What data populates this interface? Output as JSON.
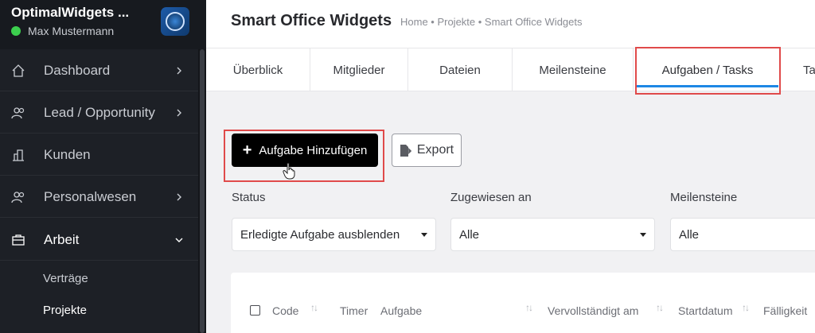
{
  "sidebar": {
    "app_title": "OptimalWidgets ...",
    "user_name": "Max Mustermann",
    "items": [
      {
        "label": "Dashboard",
        "icon": "home-icon"
      },
      {
        "label": "Lead / Opportunity",
        "icon": "users-icon"
      },
      {
        "label": "Kunden",
        "icon": "building-icon"
      },
      {
        "label": "Personalwesen",
        "icon": "users-icon"
      },
      {
        "label": "Arbeit",
        "icon": "briefcase-icon"
      }
    ],
    "sub_items": [
      {
        "label": "Verträge"
      },
      {
        "label": "Projekte"
      }
    ]
  },
  "header": {
    "title": "Smart Office Widgets",
    "breadcrumb": "Home • Projekte • Smart Office Widgets"
  },
  "tabs": [
    {
      "label": "Überblick"
    },
    {
      "label": "Mitglieder"
    },
    {
      "label": "Dateien"
    },
    {
      "label": "Meilensteine"
    },
    {
      "label": "Aufgaben / Tasks"
    },
    {
      "label": "Ta"
    }
  ],
  "toolbar": {
    "add_label": "Aufgabe Hinzufügen",
    "export_label": "Export"
  },
  "filters": [
    {
      "label": "Status",
      "value": "Erledigte Aufgabe ausblenden"
    },
    {
      "label": "Zugewiesen an",
      "value": "Alle"
    },
    {
      "label": "Meilensteine",
      "value": "Alle"
    }
  ],
  "table": {
    "columns": [
      "Code",
      "Timer",
      "Aufgabe",
      "Vervollständigt am",
      "Startdatum",
      "Fälligkeit"
    ]
  },
  "colors": {
    "sidebar_bg": "#1d2026",
    "accent": "#1e88e5",
    "highlight": "#e04a4a",
    "online": "#3ccf4e"
  }
}
